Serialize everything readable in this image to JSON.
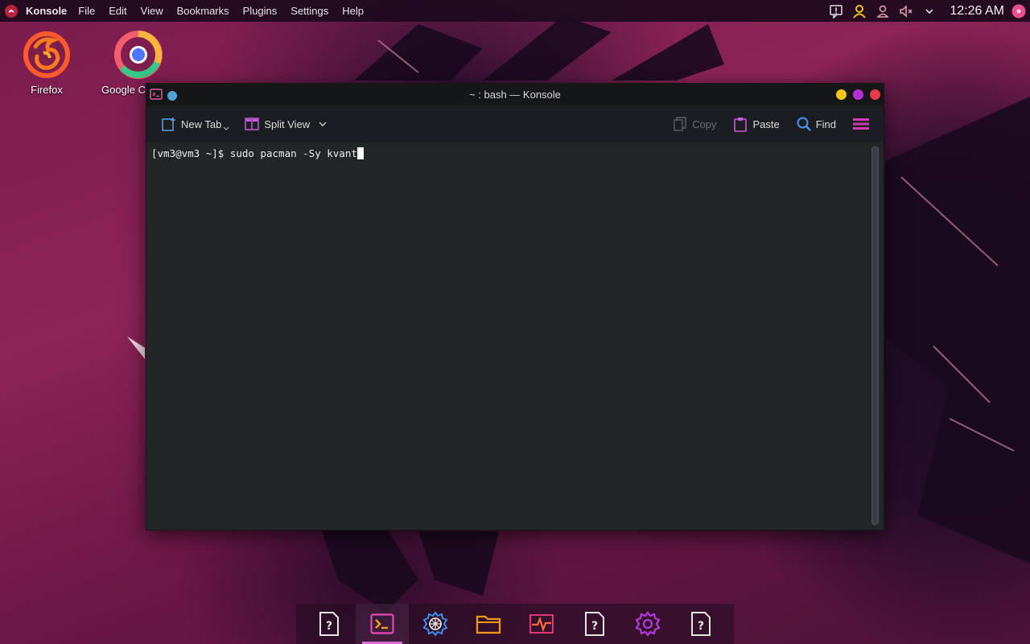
{
  "top_panel": {
    "app_name": "Konsole",
    "menu": [
      "File",
      "Edit",
      "View",
      "Bookmarks",
      "Plugins",
      "Settings",
      "Help"
    ],
    "clock": "12:26 AM",
    "tray_icons": [
      "notification-icon",
      "user-icon",
      "people-icon",
      "volume-muted-icon",
      "chevron-down-icon",
      "session-icon"
    ]
  },
  "desktop": {
    "icons": [
      {
        "label": "Firefox",
        "icon": "firefox-icon"
      },
      {
        "label": "Google C",
        "icon": "chrome-icon"
      }
    ]
  },
  "window": {
    "title": "~ : bash — Konsole",
    "toolbar": {
      "new_tab": "New Tab",
      "split_view": "Split View",
      "copy": "Copy",
      "paste": "Paste",
      "find": "Find"
    },
    "terminal": {
      "prompt": "[vm3@vm3 ~]$ ",
      "command": "sudo pacman -Sy kvant"
    }
  },
  "taskbar": {
    "items": [
      "unknown-app-icon",
      "konsole-icon",
      "network-settings-icon",
      "file-manager-icon",
      "system-monitor-icon",
      "unknown-app-icon",
      "settings-icon",
      "unknown-app-icon"
    ],
    "active_index": 1
  },
  "colors": {
    "accent": "#d86bd6",
    "wm_minimize": "#f5c518",
    "wm_maximize": "#b32fd8",
    "wm_close": "#e8384a",
    "terminal_bg": "#232627"
  }
}
